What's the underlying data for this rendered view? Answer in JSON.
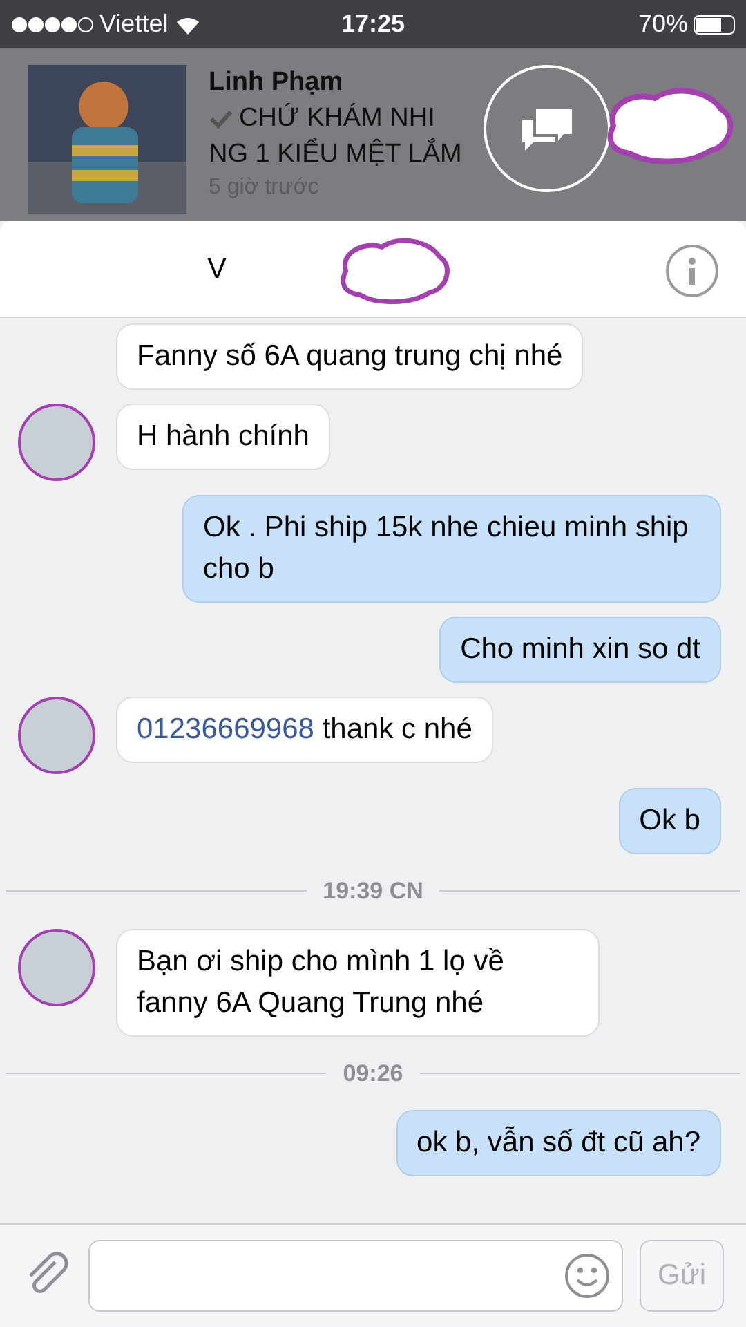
{
  "status_bar": {
    "carrier": "Viettel",
    "time": "17:25",
    "battery": "70%"
  },
  "notification": {
    "sender": "Linh Phạm",
    "lines": [
      "CHỨ KHÁM NHI",
      "NG 1 KIỂU MỆT LẮM"
    ],
    "time": "5 giờ trước"
  },
  "chat_header": {
    "title": "V"
  },
  "messages": [
    {
      "kind": "incoming",
      "avatar": false,
      "text": "Fanny số 6A quang trung chị nhé"
    },
    {
      "kind": "incoming",
      "avatar": true,
      "text": "H hành chính"
    },
    {
      "kind": "outgoing",
      "text": "Ok . Phi ship 15k nhe chieu minh ship cho b"
    },
    {
      "kind": "outgoing",
      "text": "Cho minh xin so dt"
    },
    {
      "kind": "incoming",
      "avatar": true,
      "link": "01236669968",
      "text": "thank c nhé"
    },
    {
      "kind": "outgoing",
      "text": "Ok b"
    },
    {
      "kind": "timestamp",
      "text": "19:39 CN"
    },
    {
      "kind": "incoming",
      "avatar": true,
      "text": "Bạn ơi ship cho mình 1 lọ về fanny 6A Quang Trung nhé"
    },
    {
      "kind": "timestamp",
      "text": "09:26"
    },
    {
      "kind": "outgoing",
      "text": "ok b, vẫn số đt cũ ah?"
    }
  ],
  "composer": {
    "send": "Gửi"
  }
}
